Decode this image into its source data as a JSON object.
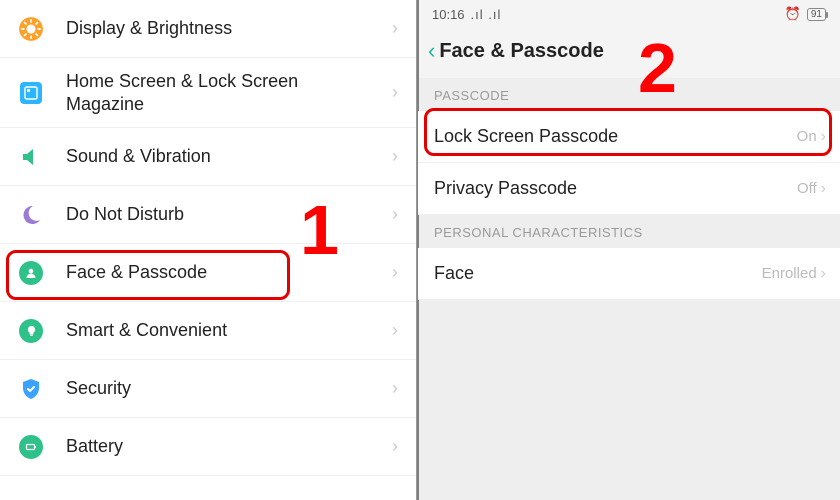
{
  "left": {
    "items": [
      {
        "label": "Display & Brightness"
      },
      {
        "label": "Home Screen & Lock Screen Magazine"
      },
      {
        "label": "Sound & Vibration"
      },
      {
        "label": "Do Not Disturb"
      },
      {
        "label": "Face & Passcode"
      },
      {
        "label": "Smart & Convenient"
      },
      {
        "label": "Security"
      },
      {
        "label": "Battery"
      }
    ]
  },
  "right": {
    "status": {
      "time": "10:16",
      "signal_glyph": ".ıl .ıl",
      "alarm_glyph": "⏰",
      "battery_pct": "91"
    },
    "nav": {
      "back_glyph": "‹",
      "title": "Face & Passcode"
    },
    "section1": "PASSCODE",
    "rows1": [
      {
        "label": "Lock Screen Passcode",
        "value": "On"
      },
      {
        "label": "Privacy Passcode",
        "value": "Off"
      }
    ],
    "section2": "PERSONAL CHARACTERISTICS",
    "rows2": [
      {
        "label": "Face",
        "value": "Enrolled"
      }
    ]
  },
  "annotations": {
    "num1": "1",
    "num2": "2"
  }
}
